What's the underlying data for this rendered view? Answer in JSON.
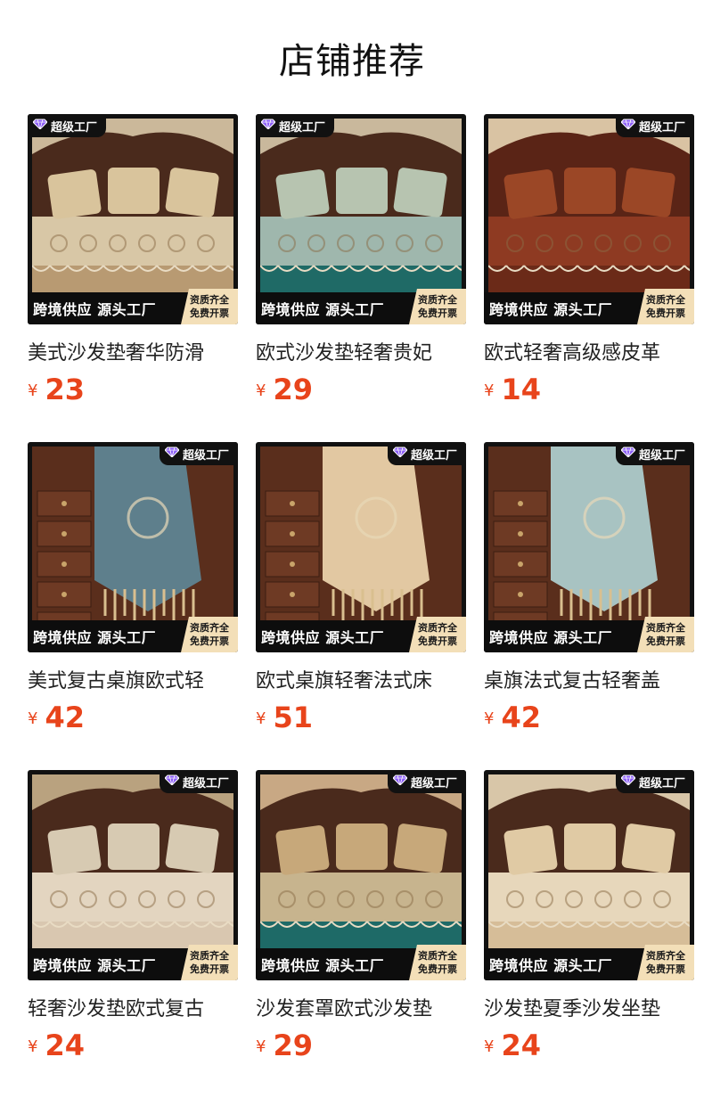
{
  "header": {
    "title": "店铺推荐"
  },
  "badge": {
    "text": "超级工厂"
  },
  "banner": {
    "text": "跨境供应 源头工厂",
    "tag_line1": "资质齐全",
    "tag_line2": "免费开票"
  },
  "currency": "¥",
  "products": [
    {
      "title": "美式沙发垫奢华防滑",
      "price": "23",
      "badge_side": "left",
      "scene": "sofa-paisley"
    },
    {
      "title": "欧式沙发垫轻奢贵妃",
      "price": "29",
      "badge_side": "left",
      "scene": "sofa-teal"
    },
    {
      "title": "欧式轻奢高级感皮革",
      "price": "14",
      "badge_side": "right",
      "scene": "sofa-leather"
    },
    {
      "title": "美式复古桌旗欧式轻",
      "price": "42",
      "badge_side": "right",
      "scene": "runner-blue"
    },
    {
      "title": "欧式桌旗轻奢法式床",
      "price": "51",
      "badge_side": "right",
      "scene": "runner-beige"
    },
    {
      "title": "桌旗法式复古轻奢盖",
      "price": "42",
      "badge_side": "right",
      "scene": "runner-mint"
    },
    {
      "title": "轻奢沙发垫欧式复古",
      "price": "24",
      "badge_side": "right",
      "scene": "sofa-cream"
    },
    {
      "title": "沙发套罩欧式沙发垫",
      "price": "29",
      "badge_side": "right",
      "scene": "sofa-teal2"
    },
    {
      "title": "沙发垫夏季沙发坐垫",
      "price": "24",
      "badge_side": "right",
      "scene": "sofa-lace"
    }
  ],
  "colors": {
    "price": "#e8441b",
    "badge_bg": "#111111",
    "tag_bg": "#f3dfb8"
  }
}
